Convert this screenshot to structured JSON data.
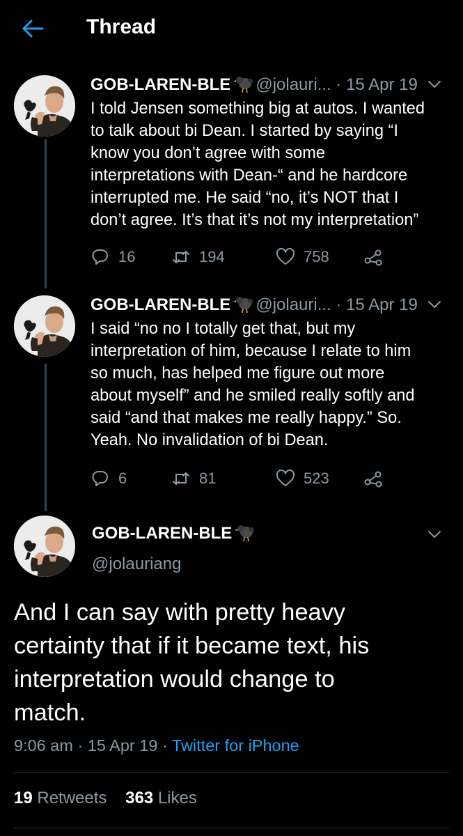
{
  "header": {
    "title": "Thread"
  },
  "account": {
    "name": "GOB-LAREN-BLE",
    "handle_truncated": "@jolauri...",
    "handle_full": "@jolauriang"
  },
  "tweets": [
    {
      "date": "15 Apr 19",
      "text": "I told Jensen something big at autos. I wanted\nto talk about bi Dean. I started by saying “I\nknow you don’t agree with some\ninterpretations with Dean-“ and he hardcore\ninterrupted me. He said “no, it’s NOT that I\ndon’t agree. It’s that it’s not my interpretation”",
      "replies": "16",
      "retweets": "194",
      "likes": "758"
    },
    {
      "date": "15 Apr 19",
      "text": "I said “no no I totally get that, but my\ninterpretation of him, because I relate to him\nso much, has helped me figure out more\nabout myself” and he smiled really softly and\nsaid “and that makes me really happy.” So.\nYeah. No invalidation of bi Dean.",
      "replies": "6",
      "retweets": "81",
      "likes": "523"
    }
  ],
  "focus": {
    "text": "And I can say with pretty heavy\ncertainty that if it became text, his\ninterpretation would change to\nmatch.",
    "time": "9:06 am",
    "date": "15 Apr 19",
    "source": "Twitter for iPhone",
    "retweets": "19",
    "retweets_label": "Retweets",
    "likes": "363",
    "likes_label": "Likes"
  },
  "separator": " · ",
  "colors": {
    "background": "#000000",
    "text": "#ffffff",
    "muted": "#8b98a5",
    "link": "#1da1f2",
    "thread_line": "#38444d"
  },
  "icons": [
    "back-arrow-icon",
    "bird-icon",
    "chevron-down-icon",
    "reply-icon",
    "retweet-icon",
    "like-icon",
    "share-icon"
  ]
}
